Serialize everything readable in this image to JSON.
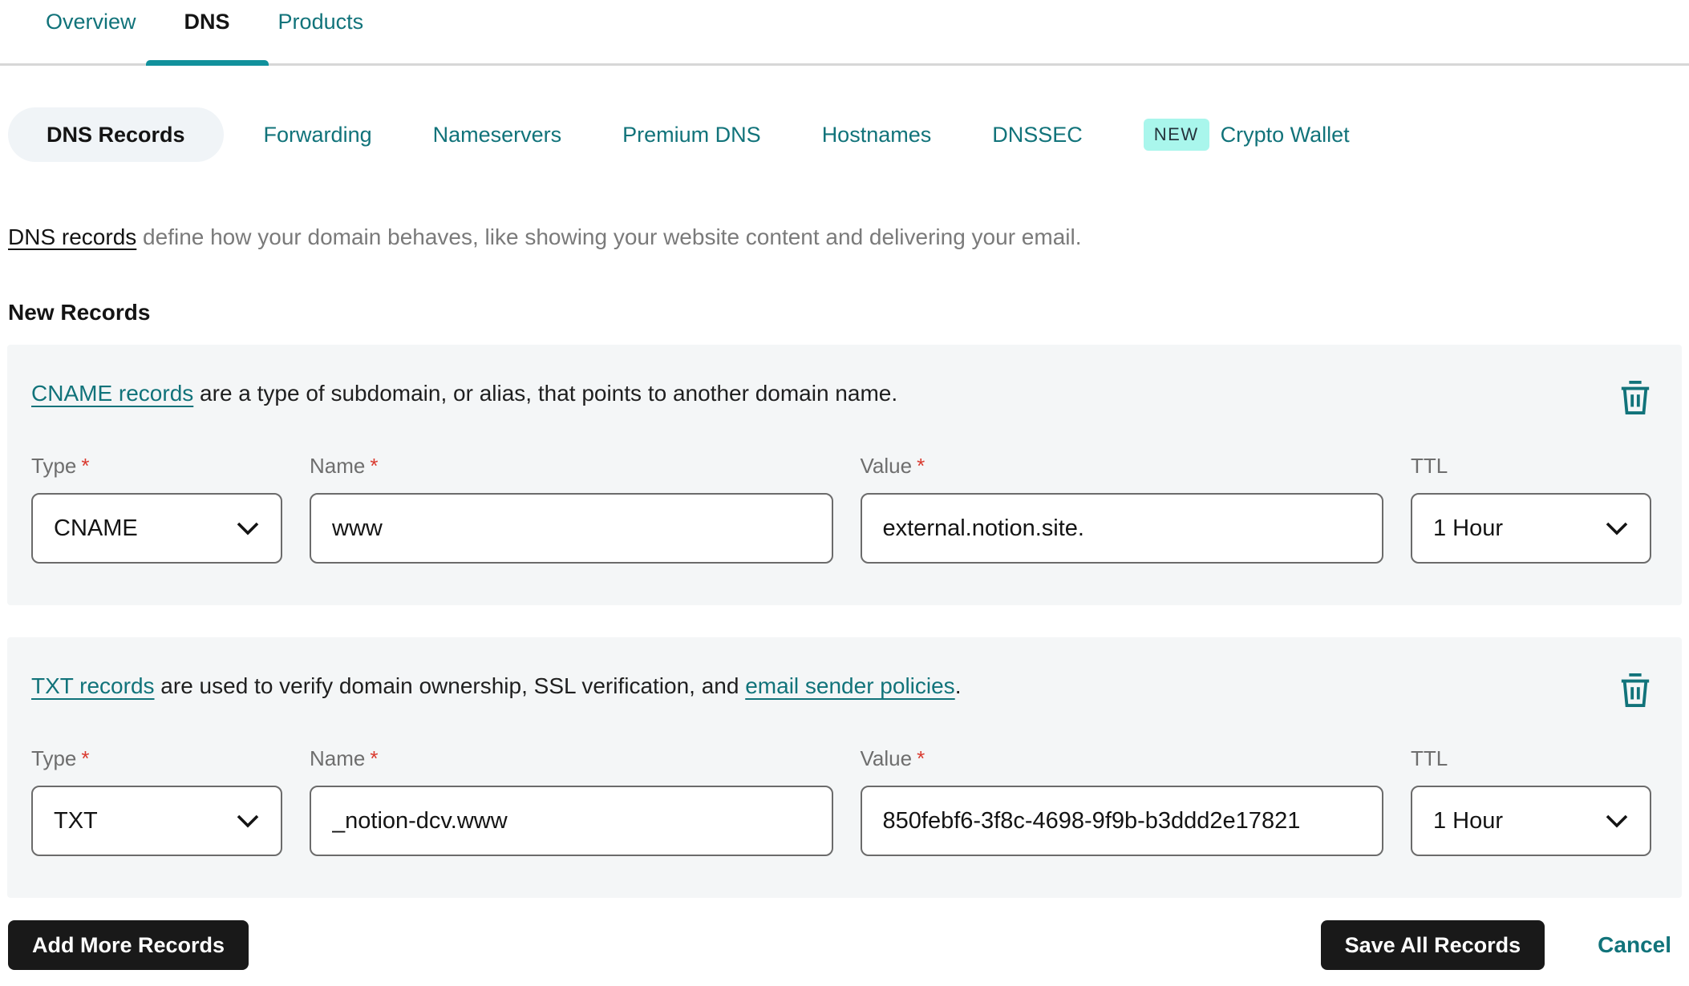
{
  "tabs": [
    {
      "label": "Overview",
      "active": false
    },
    {
      "label": "DNS",
      "active": true
    },
    {
      "label": "Products",
      "active": false
    }
  ],
  "subtabs": {
    "dns_records": "DNS Records",
    "forwarding": "Forwarding",
    "nameservers": "Nameservers",
    "premium_dns": "Premium DNS",
    "hostnames": "Hostnames",
    "dnssec": "DNSSEC",
    "crypto_wallet": "Crypto Wallet",
    "crypto_wallet_badge": "NEW"
  },
  "intro": {
    "link": "DNS records",
    "rest": " define how your domain behaves, like showing your website content and delivering your email."
  },
  "section_title": "New Records",
  "misc": {
    "required_mark": "*"
  },
  "records": {
    "0": {
      "desc_link": "CNAME records",
      "desc_mid": " are a type of subdomain, or alias, that points to another domain name.",
      "desc_link2": "",
      "desc_end": "",
      "type_label": "Type",
      "name_label": "Name",
      "value_label": "Value",
      "ttl_label": "TTL",
      "type_value": "CNAME",
      "name_value": "www",
      "value_value": "external.notion.site.",
      "ttl_value": "1 Hour"
    },
    "1": {
      "desc_link": "TXT records",
      "desc_mid": " are used to verify domain ownership, SSL verification, and ",
      "desc_link2": "email sender policies",
      "desc_end": ".",
      "type_label": "Type",
      "name_label": "Name",
      "value_label": "Value",
      "ttl_label": "TTL",
      "type_value": "TXT",
      "name_value": "_notion-dcv.www",
      "value_value": "850febf6-3f8c-4698-9f9b-b3ddd2e17821",
      "ttl_value": "1 Hour"
    }
  },
  "footer": {
    "add_label": "Add More Records",
    "save_label": "Save All Records",
    "cancel_label": "Cancel"
  },
  "colors": {
    "teal": "#11737a",
    "indicator_teal": "#11919c",
    "badge_bg": "#a9f6ec",
    "card_bg": "#f4f6f7",
    "button_bg": "#191919",
    "required_red": "#d93a2f"
  }
}
